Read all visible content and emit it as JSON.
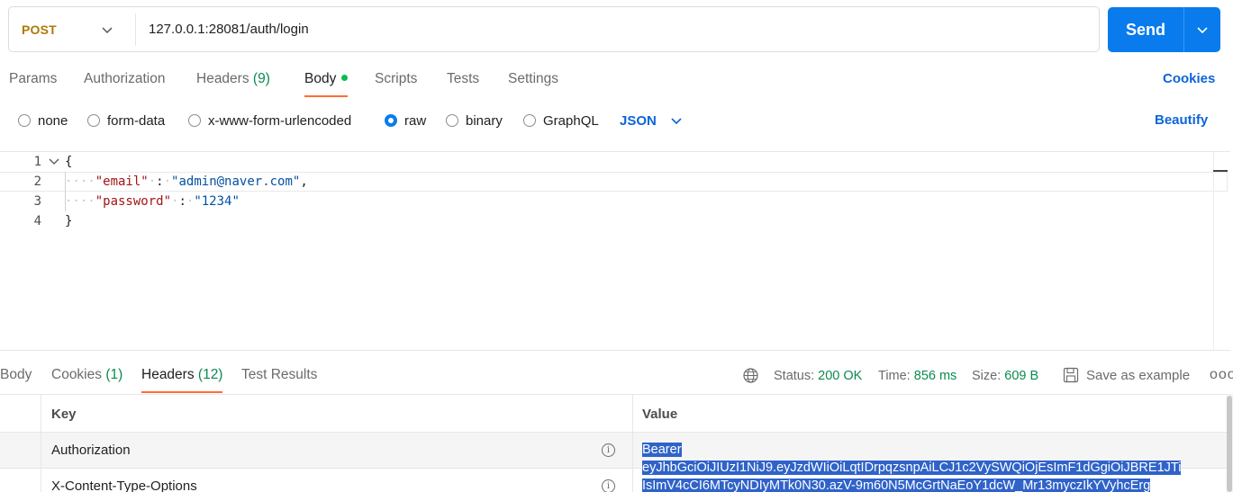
{
  "request": {
    "method": "POST",
    "url": "127.0.0.1:28081/auth/login",
    "send_label": "Send"
  },
  "request_tabs": [
    {
      "label": "Params"
    },
    {
      "label": "Authorization"
    },
    {
      "label": "Headers",
      "count": "(9)"
    },
    {
      "label": "Body"
    },
    {
      "label": "Scripts"
    },
    {
      "label": "Tests"
    },
    {
      "label": "Settings"
    }
  ],
  "cookies_link": "Cookies",
  "body_types": [
    {
      "label": "none"
    },
    {
      "label": "form-data"
    },
    {
      "label": "x-www-form-urlencoded"
    },
    {
      "label": "raw",
      "selected": true
    },
    {
      "label": "binary"
    },
    {
      "label": "GraphQL"
    }
  ],
  "format_select": "JSON",
  "beautify_label": "Beautify",
  "editor": {
    "line_numbers": [
      "1",
      "2",
      "3",
      "4"
    ],
    "open_brace": "{",
    "close_brace": "}",
    "key1": "\"email\"",
    "val1": "\"admin@naver.com\"",
    "key2": "\"password\"",
    "val2": "\"1234\""
  },
  "response_tabs": [
    {
      "label": "Body"
    },
    {
      "label": "Cookies",
      "count": "(1)"
    },
    {
      "label": "Headers",
      "count": "(12)"
    },
    {
      "label": "Test Results"
    }
  ],
  "response_meta": {
    "status_label": "Status:",
    "status_value": "200 OK",
    "time_label": "Time:",
    "time_value": "856 ms",
    "size_label": "Size:",
    "size_value": "609 B",
    "save_label": "Save as example",
    "more": "ooo"
  },
  "headers_table": {
    "key_header": "Key",
    "value_header": "Value",
    "rows": [
      {
        "key": "Authorization",
        "value_lines": [
          "Bearer",
          "eyJhbGciOiJIUzI1NiJ9.eyJzdWIiOiLqtIDrpqzsnpAiLCJ1c2VySWQiOjEsImF1dGgiOiJBRE1JTi",
          "IsImV4cCI6MTcyNDIyMTk0N30.azV-9m60N5McGrtNaEoY1dcW_Mr13myczIkYVyhcErg"
        ]
      },
      {
        "key": "X-Content-Type-Options"
      }
    ]
  },
  "colors": {
    "accent": "#097bed",
    "tab_underline": "#ff6c37",
    "method_post": "#ad7a03",
    "status_green": "#0c8a4e",
    "selection": "#2f63c9"
  }
}
